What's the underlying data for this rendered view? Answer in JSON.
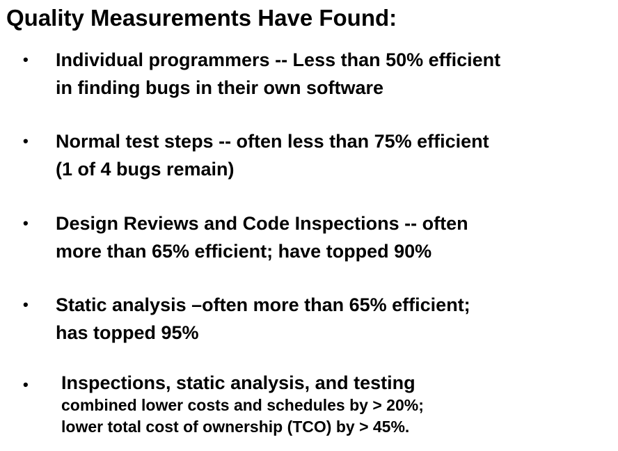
{
  "title": "Quality Measurements Have Found:",
  "bullet_glyph": "•",
  "bullets": [
    {
      "lines": [
        "Individual programmers -- Less than 50% efficient",
        "in finding bugs in their own software"
      ]
    },
    {
      "lines": [
        "Normal test steps -- often less than 75% efficient",
        "(1 of 4 bugs remain)"
      ]
    },
    {
      "lines": [
        "Design Reviews and Code Inspections -- often",
        "more than 65% efficient; have topped 90%"
      ]
    },
    {
      "lines": [
        "Static analysis –often more than 65% efficient;",
        "has topped 95%"
      ]
    },
    {
      "lines": [
        "Inspections, static analysis, and testing",
        "combined lower costs and schedules by > 20%;",
        "lower total cost of ownership (TCO) by > 45%."
      ]
    }
  ]
}
